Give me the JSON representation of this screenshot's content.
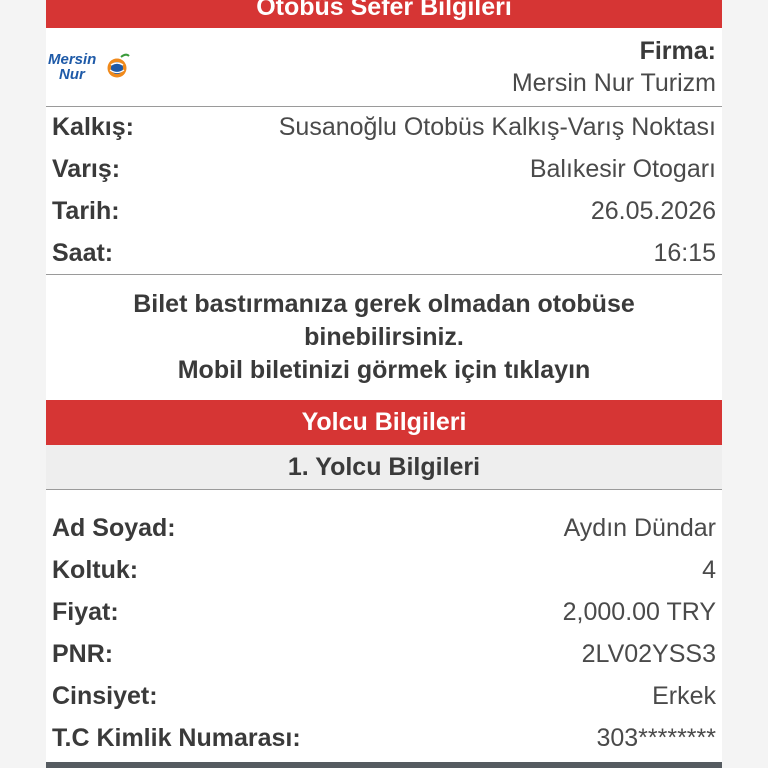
{
  "sections": {
    "trip_header": "Otobüs Sefer Bilgileri",
    "passenger_header": "Yolcu Bilgileri",
    "passenger_subheader": "1. Yolcu Bilgileri"
  },
  "company": {
    "logo_text_line1": "Mersin",
    "logo_text_line2": "Nur",
    "label": "Firma:",
    "value": "Mersin Nur Turizm"
  },
  "trip": [
    {
      "label": "Kalkış:",
      "value": "Susanoğlu Otobüs Kalkış-Varış Noktası"
    },
    {
      "label": "Varış:",
      "value": "Balıkesir Otogarı"
    },
    {
      "label": "Tarih:",
      "value": "26.05.2026"
    },
    {
      "label": "Saat:",
      "value": "16:15"
    }
  ],
  "notice": {
    "line1": "Bilet bastırmanıza gerek olmadan otobüse",
    "line2": "binebilirsiniz.",
    "link": "Mobil biletinizi görmek için tıklayın"
  },
  "passenger": [
    {
      "label": "Ad Soyad:",
      "value": "Aydın Dündar"
    },
    {
      "label": "Koltuk:",
      "value": "4"
    },
    {
      "label": "Fiyat:",
      "value": "2,000.00 TRY"
    },
    {
      "label": "PNR:",
      "value": "2LV02YSS3"
    },
    {
      "label": "Cinsiyet:",
      "value": "Erkek"
    },
    {
      "label": "T.C Kimlik Numarası:",
      "value": "303********"
    }
  ],
  "colors": {
    "header_red": "#d63534",
    "logo_blue": "#1e5aa8",
    "logo_orange": "#f08a1c"
  }
}
